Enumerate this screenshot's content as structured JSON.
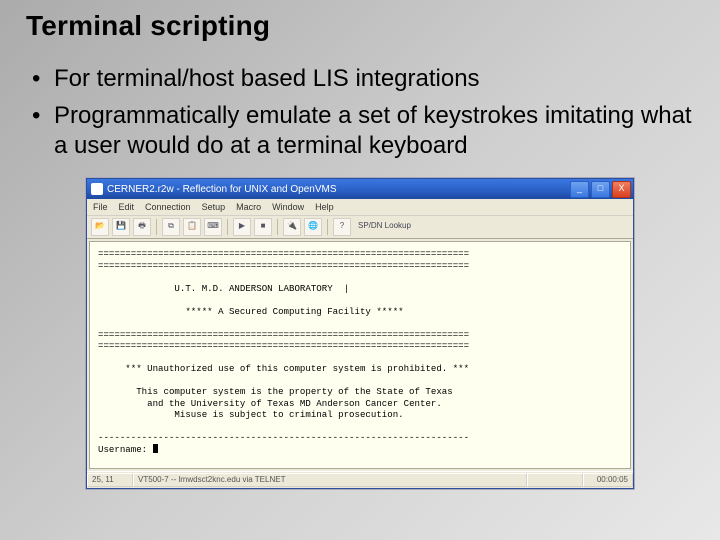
{
  "title": "Terminal scripting",
  "bullets": [
    "For terminal/host based LIS integrations",
    "Programmatically emulate a set of keystrokes imitating what a user would do at a terminal keyboard"
  ],
  "window": {
    "title": "CERNER2.r2w - Reflection for UNIX and OpenVMS",
    "buttons": {
      "min": "_",
      "max": "□",
      "close": "X"
    },
    "menu": [
      "File",
      "Edit",
      "Connection",
      "Setup",
      "Macro",
      "Window",
      "Help"
    ],
    "toolbar_right": "SP/DN Lookup",
    "terminal": {
      "divider": "====================================================================",
      "lab_name": "U.T. M.D. ANDERSON LABORATORY  |",
      "secured": "***** A Secured Computing Facility *****",
      "warn": "*** Unauthorized use of this computer system is prohibited. ***",
      "prop1": "This computer system is the property of the State of Texas",
      "prop2": "and the University of Texas MD Anderson Cancer Center.",
      "prop3": "Misuse is subject to criminal prosecution.",
      "divider_dash": "--------------------------------------------------------------------",
      "prompt": "Username: "
    },
    "status": {
      "pos": "25, 11",
      "host": "VT500-7 -- lrnwdsct2knc.edu via TELNET",
      "time": "00:00:05"
    }
  }
}
